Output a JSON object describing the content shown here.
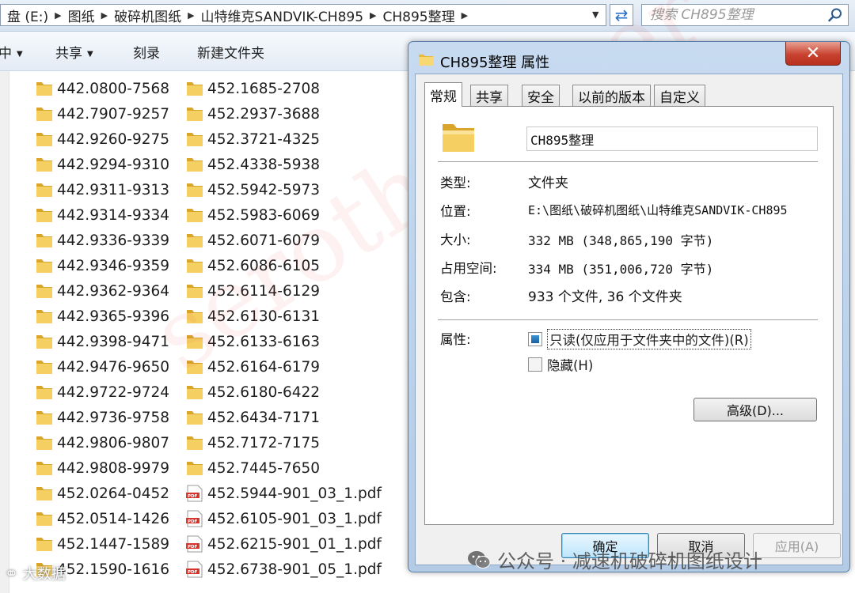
{
  "address_bar": {
    "crumbs": [
      "盘 (E:)",
      "图纸",
      "破碎机图纸",
      "山特维克SANDVIK-CH895",
      "CH895整理"
    ],
    "search_placeholder": "搜索 CH895整理"
  },
  "toolbar": {
    "items": [
      {
        "label": "中",
        "has_dropdown": true
      },
      {
        "label": "共享",
        "has_dropdown": true
      },
      {
        "label": "刻录",
        "has_dropdown": false
      },
      {
        "label": "新建文件夹",
        "has_dropdown": false
      }
    ]
  },
  "files": {
    "column1": [
      {
        "name": "442.0800-7568",
        "type": "folder"
      },
      {
        "name": "442.7907-9257",
        "type": "folder"
      },
      {
        "name": "442.9260-9275",
        "type": "folder"
      },
      {
        "name": "442.9294-9310",
        "type": "folder"
      },
      {
        "name": "442.9311-9313",
        "type": "folder"
      },
      {
        "name": "442.9314-9334",
        "type": "folder"
      },
      {
        "name": "442.9336-9339",
        "type": "folder"
      },
      {
        "name": "442.9346-9359",
        "type": "folder"
      },
      {
        "name": "442.9362-9364",
        "type": "folder"
      },
      {
        "name": "442.9365-9396",
        "type": "folder"
      },
      {
        "name": "442.9398-9471",
        "type": "folder"
      },
      {
        "name": "442.9476-9650",
        "type": "folder"
      },
      {
        "name": "442.9722-9724",
        "type": "folder"
      },
      {
        "name": "442.9736-9758",
        "type": "folder"
      },
      {
        "name": "442.9806-9807",
        "type": "folder"
      },
      {
        "name": "442.9808-9979",
        "type": "folder"
      },
      {
        "name": "452.0264-0452",
        "type": "folder"
      },
      {
        "name": "452.0514-1426",
        "type": "folder"
      },
      {
        "name": "452.1447-1589",
        "type": "folder"
      },
      {
        "name": "452.1590-1616",
        "type": "folder"
      }
    ],
    "column2": [
      {
        "name": "452.1685-2708",
        "type": "folder"
      },
      {
        "name": "452.2937-3688",
        "type": "folder"
      },
      {
        "name": "452.3721-4325",
        "type": "folder"
      },
      {
        "name": "452.4338-5938",
        "type": "folder"
      },
      {
        "name": "452.5942-5973",
        "type": "folder"
      },
      {
        "name": "452.5983-6069",
        "type": "folder"
      },
      {
        "name": "452.6071-6079",
        "type": "folder"
      },
      {
        "name": "452.6086-6105",
        "type": "folder"
      },
      {
        "name": "452.6114-6129",
        "type": "folder"
      },
      {
        "name": "452.6130-6131",
        "type": "folder"
      },
      {
        "name": "452.6133-6163",
        "type": "folder"
      },
      {
        "name": "452.6164-6179",
        "type": "folder"
      },
      {
        "name": "452.6180-6422",
        "type": "folder"
      },
      {
        "name": "452.6434-7171",
        "type": "folder"
      },
      {
        "name": "452.7172-7175",
        "type": "folder"
      },
      {
        "name": "452.7445-7650",
        "type": "folder"
      },
      {
        "name": "452.5944-901_03_1.pdf",
        "type": "pdf"
      },
      {
        "name": "452.6105-901_03_1.pdf",
        "type": "pdf"
      },
      {
        "name": "452.6215-901_01_1.pdf",
        "type": "pdf"
      },
      {
        "name": "452.6738-901_05_1.pdf",
        "type": "pdf"
      }
    ]
  },
  "dialog": {
    "title": "CH895整理 属性",
    "close_label": "✕",
    "tabs": [
      "常规",
      "共享",
      "安全",
      "以前的版本",
      "自定义"
    ],
    "active_tab": "常规",
    "folder_name": "CH895整理",
    "type_label": "类型:",
    "type_value": "文件夹",
    "location_label": "位置:",
    "location_value": "E:\\图纸\\破碎机图纸\\山特维克SANDVIK-CH895",
    "size_label": "大小:",
    "size_value": "332 MB (348,865,190 字节)",
    "disk_label": "占用空间:",
    "disk_value": "334 MB (351,006,720 字节)",
    "contains_label": "包含:",
    "contains_value": "933 个文件, 36 个文件夹",
    "attributes_label": "属性:",
    "readonly_label": "只读(仅应用于文件夹中的文件)(R)",
    "readonly_state": "indeterminate",
    "hidden_label": "隐藏(H)",
    "hidden_checked": false,
    "advanced_label": "高级(D)...",
    "ok_label": "确定",
    "cancel_label": "取消",
    "apply_label": "应用(A)"
  },
  "watermarks": {
    "diagonal": "serothrducer",
    "wechat": "公众号 · 减速机破碎机图纸设计",
    "corner": "大数据"
  },
  "colors": {
    "folder_yellow": "#f2c94c",
    "pdf_red": "#d9342b",
    "title_bar": "#c7daf0",
    "close_red": "#c8432f"
  }
}
